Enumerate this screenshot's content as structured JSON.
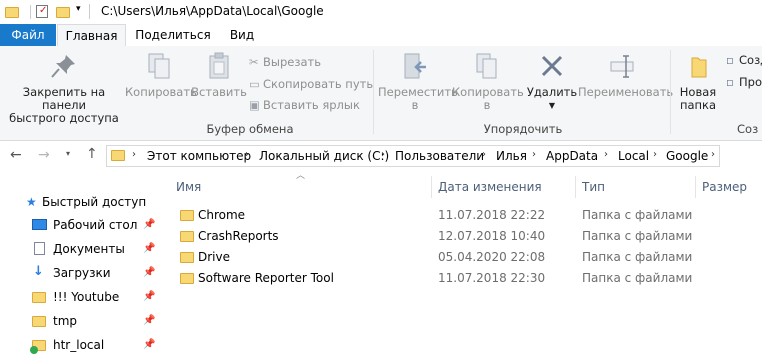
{
  "window": {
    "path_title": "C:\\Users\\Илья\\AppData\\Local\\Google"
  },
  "tabs": [
    {
      "label": "Файл"
    },
    {
      "label": "Главная"
    },
    {
      "label": "Поделиться"
    },
    {
      "label": "Вид"
    }
  ],
  "ribbon": {
    "pin_label_1": "Закрепить на панели",
    "pin_label_2": "быстрого доступа",
    "copy": "Копировать",
    "paste": "Вставить",
    "cut": "Вырезать",
    "copy_path": "Скопировать путь",
    "paste_shortcut": "Вставить ярлык",
    "clipboard_group": "Буфер обмена",
    "move_to_1": "Переместить",
    "move_to_2": "в",
    "copy_to_1": "Копировать",
    "copy_to_2": "в",
    "delete": "Удалить",
    "rename": "Переименовать",
    "organize_group": "Упорядочить",
    "new_folder_1": "Новая",
    "new_folder_2": "папка",
    "create_partial_1": "Созд",
    "create_partial_2": "Про",
    "create_group_partial": "Соз"
  },
  "address": {
    "crumbs": [
      "Этот компьютер",
      "Локальный диск (C:)",
      "Пользователи",
      "Илья",
      "AppData",
      "Local",
      "Google"
    ]
  },
  "nav": {
    "quick_access": "Быстрый доступ",
    "items": [
      {
        "label": "Рабочий стол",
        "icon": "desktop-icon"
      },
      {
        "label": "Документы",
        "icon": "documents-icon"
      },
      {
        "label": "Загрузки",
        "icon": "downloads-icon"
      },
      {
        "label": "!!! Youtube",
        "icon": "folder-icon"
      },
      {
        "label": "tmp",
        "icon": "folder-icon"
      },
      {
        "label": "htr_local",
        "icon": "folder-sync-icon"
      }
    ]
  },
  "columns": {
    "name": "Имя",
    "date": "Дата изменения",
    "type": "Тип",
    "size": "Размер"
  },
  "files": [
    {
      "name": "Chrome",
      "date": "11.07.2018 22:22",
      "type": "Папка с файлами"
    },
    {
      "name": "CrashReports",
      "date": "12.07.2018 10:40",
      "type": "Папка с файлами"
    },
    {
      "name": "Drive",
      "date": "05.04.2020 22:08",
      "type": "Папка с файлами"
    },
    {
      "name": "Software Reporter Tool",
      "date": "11.07.2018 22:30",
      "type": "Папка с файлами"
    }
  ],
  "colors": {
    "file_tab": "#1979ca",
    "header_text": "#4c607a",
    "folder": "#f8d775"
  }
}
